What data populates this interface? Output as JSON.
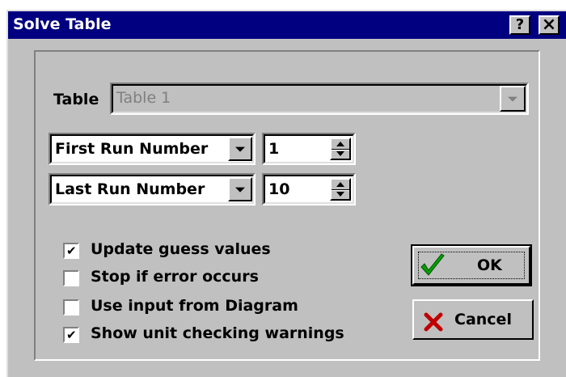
{
  "window": {
    "title": "Solve Table",
    "help_button": "?",
    "close_button": "×"
  },
  "table": {
    "label": "Table",
    "value": "Table 1"
  },
  "first_run": {
    "mode": "First Run Number",
    "value": "1"
  },
  "last_run": {
    "mode": "Last Run Number",
    "value": "10"
  },
  "options": [
    {
      "label": "Update guess values",
      "checked": true
    },
    {
      "label": "Stop if error occurs",
      "checked": false
    },
    {
      "label": "Use input from Diagram",
      "checked": false
    },
    {
      "label": "Show unit checking warnings",
      "checked": true
    }
  ],
  "buttons": {
    "ok": "OK",
    "cancel": "Cancel"
  },
  "colors": {
    "titlebar": "#000080",
    "face": "#c0c0c0",
    "ok_icon": "#00a000",
    "cancel_icon": "#c00000"
  },
  "icons": {
    "ok": "green-checkmark-icon",
    "cancel": "red-x-icon"
  }
}
